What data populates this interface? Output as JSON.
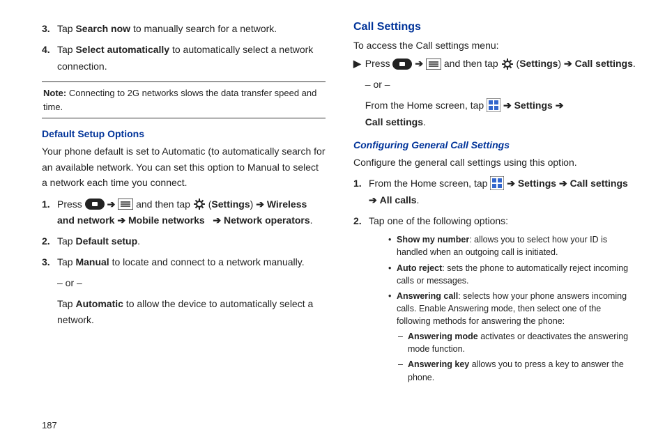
{
  "left": {
    "step3_pre": "Tap ",
    "step3_bold": "Search now",
    "step3_post": " to manually search for a network.",
    "step4_pre": "Tap ",
    "step4_bold": "Select automatically",
    "step4_post": " to automatically select a network connection.",
    "note_label": "Note:",
    "note_text": " Connecting to 2G networks slows the data transfer speed and time.",
    "heading1": "Default Setup Options",
    "para1": "Your phone default is set to Automatic (to automatically search for an available network. You can set this option to Manual to select a network each time you connect.",
    "ds1_press": "Press ",
    "ds1_andthen": " and then tap ",
    "ds1_settings": "Settings",
    "ds1_wireless": "Wireless and network",
    "ds1_mobile": "Mobile networks",
    "ds1_operators": "Network operators",
    "ds2_pre": "Tap ",
    "ds2_bold": "Default setup",
    "ds3_pre": "Tap ",
    "ds3_bold": "Manual",
    "ds3_post": " to locate and connect to a network manually.",
    "or": "– or –",
    "ds3b_pre": "Tap ",
    "ds3b_bold": "Automatic",
    "ds3b_post": " to allow the device to automatically select a network."
  },
  "right": {
    "heading_big": "Call Settings",
    "access": "To access the Call settings menu:",
    "press": "Press ",
    "andthen": " and then tap ",
    "settings": "Settings",
    "callsettings": "Call settings",
    "or": "– or –",
    "fromhome": "From the Home screen, tap ",
    "arrow_settings": " Settings ",
    "heading_italic": "Configuring General Call Settings",
    "configure": "Configure the general call settings using this option.",
    "cs1_pre": "From the Home screen, tap ",
    "cs1_set": " Settings ",
    "cs1_call": " Call settings ",
    "cs1_all": " All calls",
    "cs2": "Tap one of the following options:",
    "b1_bold": "Show my number",
    "b1_txt": ": allows you to select how your ID is handled when an outgoing call is initiated.",
    "b2_bold": "Auto reject",
    "b2_txt": ": sets the phone to automatically reject incoming calls or messages.",
    "b3_bold": "Answering call",
    "b3_txt": ": selects how your phone answers incoming calls. Enable Answering mode, then select one of the following methods for answering the phone:",
    "d1_bold": "Answering mode",
    "d1_txt": " activates or deactivates the answering mode function.",
    "d2_bold": "Answering key",
    "d2_txt": " allows you to press a key to answer the phone."
  },
  "pagenum": "187",
  "nums": {
    "n1": "1.",
    "n2": "2.",
    "n3": "3.",
    "n4": "4."
  },
  "glyphs": {
    "arrow": "➔",
    "bullet": "•",
    "dash": "–",
    "tri": "▶",
    "lparen": "(",
    "rparen": ")",
    "period": "."
  }
}
